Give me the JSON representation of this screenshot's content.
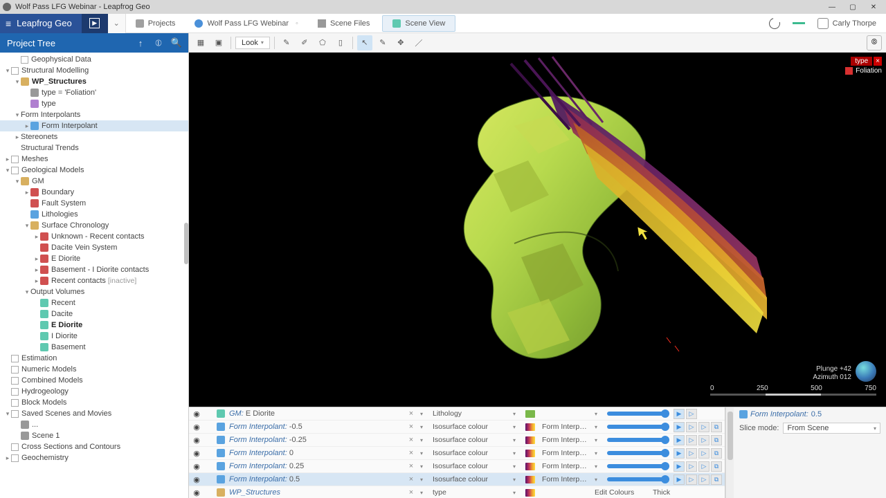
{
  "window_title": "Wolf Pass LFG Webinar - Leapfrog Geo",
  "brand": "Leapfrog Geo",
  "breadcrumbs": {
    "projects": "Projects",
    "project": "Wolf Pass LFG Webinar",
    "scene_files": "Scene Files",
    "scene_view": "Scene View"
  },
  "user_name": "Carly Thorpe",
  "sidebar_title": "Project Tree",
  "look_button": "Look",
  "legend": {
    "header": "type",
    "item": "Foliation"
  },
  "orientation": {
    "plunge": "Plunge +42",
    "azimuth": "Azimuth 012"
  },
  "scale_ticks": [
    "0",
    "250",
    "500",
    "750"
  ],
  "tree": [
    {
      "depth": 1,
      "check": true,
      "icon": "",
      "label": "Geophysical Data"
    },
    {
      "depth": 0,
      "toggle": "▾",
      "check": true,
      "icon": "",
      "label": "Structural Modelling"
    },
    {
      "depth": 1,
      "toggle": "▾",
      "icon": "ti-folder",
      "label": "WP_Structures",
      "bold": true
    },
    {
      "depth": 2,
      "icon": "ti-grey",
      "label": "type = 'Foliation'"
    },
    {
      "depth": 2,
      "icon": "ti-purple",
      "label": "type"
    },
    {
      "depth": 1,
      "toggle": "▾",
      "icon": "",
      "label": "Form Interpolants"
    },
    {
      "depth": 2,
      "toggle": "▸",
      "icon": "ti-blue",
      "label": "Form Interpolant",
      "selected": true
    },
    {
      "depth": 1,
      "toggle": "▸",
      "icon": "",
      "label": "Stereonets"
    },
    {
      "depth": 1,
      "icon": "",
      "label": "Structural Trends"
    },
    {
      "depth": 0,
      "toggle": "▸",
      "check": true,
      "icon": "",
      "label": "Meshes"
    },
    {
      "depth": 0,
      "toggle": "▾",
      "check": true,
      "icon": "",
      "label": "Geological Models"
    },
    {
      "depth": 1,
      "toggle": "▾",
      "icon": "ti-folder",
      "label": "GM"
    },
    {
      "depth": 2,
      "toggle": "▸",
      "icon": "ti-red",
      "label": "Boundary"
    },
    {
      "depth": 2,
      "icon": "ti-red",
      "label": "Fault System"
    },
    {
      "depth": 2,
      "icon": "ti-blue",
      "label": "Lithologies"
    },
    {
      "depth": 2,
      "toggle": "▾",
      "icon": "ti-folder",
      "label": "Surface Chronology"
    },
    {
      "depth": 3,
      "toggle": "▸",
      "icon": "ti-red",
      "label": "Unknown - Recent contacts"
    },
    {
      "depth": 3,
      "icon": "ti-red",
      "label": "Dacite Vein System"
    },
    {
      "depth": 3,
      "toggle": "▸",
      "icon": "ti-red",
      "label": "E Diorite"
    },
    {
      "depth": 3,
      "toggle": "▸",
      "icon": "ti-red",
      "label": "Basement - I Diorite contacts"
    },
    {
      "depth": 3,
      "toggle": "▸",
      "icon": "ti-red",
      "label": "Recent contacts",
      "sub": "[inactive]"
    },
    {
      "depth": 2,
      "toggle": "▾",
      "icon": "",
      "label": "Output Volumes"
    },
    {
      "depth": 3,
      "icon": "ti-mesh",
      "label": "Recent"
    },
    {
      "depth": 3,
      "icon": "ti-mesh",
      "label": "Dacite"
    },
    {
      "depth": 3,
      "icon": "ti-mesh",
      "label": "E Diorite",
      "bold": true
    },
    {
      "depth": 3,
      "icon": "ti-mesh",
      "label": "I Diorite"
    },
    {
      "depth": 3,
      "icon": "ti-mesh",
      "label": "Basement"
    },
    {
      "depth": 0,
      "check": true,
      "icon": "",
      "label": "Estimation"
    },
    {
      "depth": 0,
      "check": true,
      "icon": "",
      "label": "Numeric Models"
    },
    {
      "depth": 0,
      "check": true,
      "icon": "",
      "label": "Combined Models"
    },
    {
      "depth": 0,
      "check": true,
      "icon": "",
      "label": "Hydrogeology"
    },
    {
      "depth": 0,
      "check": true,
      "icon": "",
      "label": "Block Models"
    },
    {
      "depth": 0,
      "toggle": "▾",
      "check": true,
      "icon": "",
      "label": "Saved Scenes and Movies"
    },
    {
      "depth": 1,
      "icon": "ti-grey",
      "label": "..."
    },
    {
      "depth": 1,
      "icon": "ti-grey",
      "label": "Scene 1"
    },
    {
      "depth": 0,
      "check": true,
      "icon": "",
      "label": "Cross Sections and Contours"
    },
    {
      "depth": 0,
      "toggle": "▸",
      "check": true,
      "icon": "",
      "label": "Geochemistry"
    }
  ],
  "scene_list": [
    {
      "icon": "ti-mesh",
      "name": "GM:",
      "suffix": "E Diorite",
      "colorby": "Lithology",
      "swatch": "solid",
      "collabel": "",
      "extra": 2
    },
    {
      "icon": "ti-blue",
      "name": "Form Interpolant:",
      "suffix": "-0.5",
      "colorby": "Isosurface colour",
      "swatch": "grad",
      "collabel": "Form Interp…",
      "extra": 4
    },
    {
      "icon": "ti-blue",
      "name": "Form Interpolant:",
      "suffix": "-0.25",
      "colorby": "Isosurface colour",
      "swatch": "grad",
      "collabel": "Form Interp…",
      "extra": 4
    },
    {
      "icon": "ti-blue",
      "name": "Form Interpolant:",
      "suffix": "0",
      "colorby": "Isosurface colour",
      "swatch": "grad",
      "collabel": "Form Interp…",
      "extra": 4
    },
    {
      "icon": "ti-blue",
      "name": "Form Interpolant:",
      "suffix": "0.25",
      "colorby": "Isosurface colour",
      "swatch": "grad",
      "collabel": "Form Interp…",
      "extra": 4
    },
    {
      "icon": "ti-blue",
      "name": "Form Interpolant:",
      "suffix": "0.5",
      "colorby": "Isosurface colour",
      "swatch": "grad",
      "collabel": "Form Interp…",
      "extra": 4,
      "sel": true
    },
    {
      "icon": "ti-folder",
      "name": "WP_Structures",
      "suffix": "",
      "colorby": "type",
      "swatch": "grad",
      "collabel": "Edit Colours",
      "thick": "Thick",
      "extra": 0
    }
  ],
  "props": {
    "title_prefix": "Form Interpolant:",
    "title_suffix": "0.5",
    "slice_label": "Slice mode:",
    "slice_value": "From Scene"
  }
}
